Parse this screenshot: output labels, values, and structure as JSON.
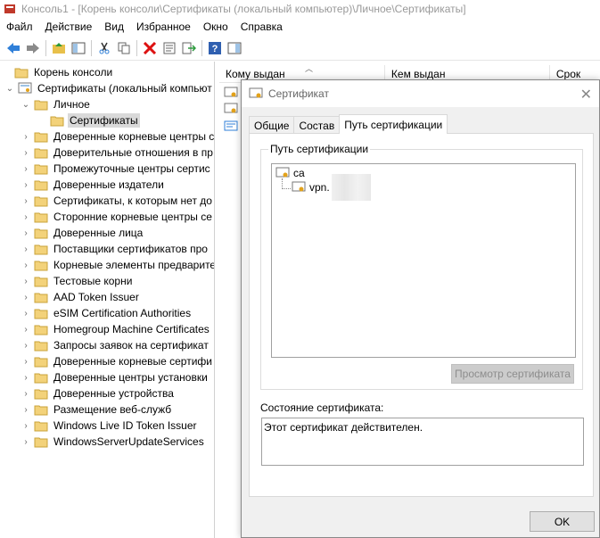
{
  "window": {
    "title": "Консоль1 - [Корень консоли\\Сертификаты (локальный компьютер)\\Личное\\Сертификаты]"
  },
  "menu": [
    "Файл",
    "Действие",
    "Вид",
    "Избранное",
    "Окно",
    "Справка"
  ],
  "toolbar": {
    "icons": [
      "back-icon",
      "forward-icon",
      "up-folder-icon",
      "show-tree-icon",
      "cut-icon",
      "copy-icon",
      "delete-icon",
      "properties-icon",
      "export-icon",
      "help-icon",
      "action-pane-icon"
    ]
  },
  "tree": {
    "root": "Корень консоли",
    "certs_local": "Сертификаты (локальный компьют",
    "personal": "Личное",
    "certificates": "Сертификаты",
    "items": [
      "Доверенные корневые центры с",
      "Доверительные отношения в пр",
      "Промежуточные центры сертис",
      "Доверенные издатели",
      "Сертификаты, к которым нет до",
      "Сторонние корневые центры се",
      "Доверенные лица",
      "Поставщики сертификатов про",
      "Корневые элементы предварите",
      "Тестовые корни",
      "AAD Token Issuer",
      "eSIM Certification Authorities",
      "Homegroup Machine Certificates",
      "Запросы заявок на сертификат",
      "Доверенные корневые сертифи",
      "Доверенные центры установки",
      "Доверенные устройства",
      "Размещение веб-служб",
      "Windows Live ID Token Issuer",
      "WindowsServerUpdateServices"
    ]
  },
  "list": {
    "columns": [
      "Кому выдан",
      "Кем выдан",
      "Срок"
    ]
  },
  "dialog": {
    "title": "Сертификат",
    "tabs": [
      "Общие",
      "Состав",
      "Путь сертификации"
    ],
    "path_group": "Путь сертификации",
    "path_root": "ca",
    "path_child": "vpn.",
    "view_button": "Просмотр сертификата",
    "status_label": "Состояние сертификата:",
    "status_text": "Этот сертификат действителен.",
    "ok": "OK"
  }
}
